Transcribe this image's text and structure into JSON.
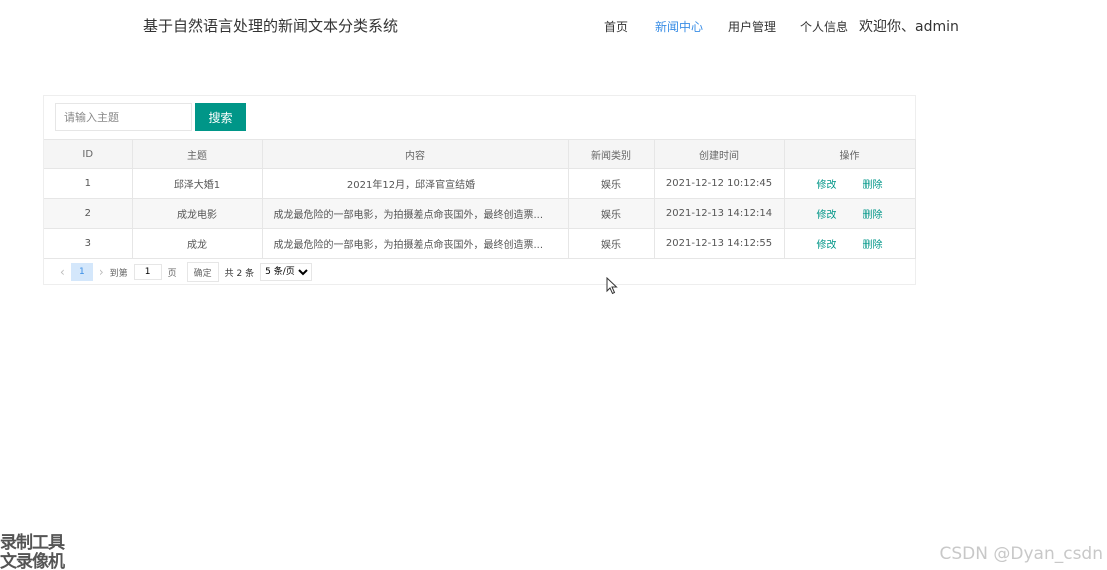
{
  "header": {
    "app_title": "基于自然语言处理的新闻文本分类系统",
    "nav": [
      {
        "label": "首页",
        "active": false
      },
      {
        "label": "新闻中心",
        "active": true
      },
      {
        "label": "用户管理",
        "active": false
      },
      {
        "label": "个人信息",
        "active": false
      }
    ],
    "welcome": "欢迎你、admin",
    "active_color": "#3a8ee6"
  },
  "search": {
    "placeholder": "请输入主题",
    "value": "",
    "button_label": "搜索",
    "button_color": "#009688"
  },
  "table": {
    "columns": [
      "ID",
      "主题",
      "内容",
      "新闻类别",
      "创建时间",
      "操作"
    ],
    "rows": [
      {
        "id": "1",
        "title": "邱泽大婚1",
        "content": "2021年12月，邱泽官宣结婚",
        "category": "娱乐",
        "created": "2021-12-12 10:12:45",
        "edit": "修改",
        "delete": "删除"
      },
      {
        "id": "2",
        "title": "成龙电影",
        "content": "成龙最危险的一部电影，为拍摄差点命丧国外，最终创造票...",
        "category": "娱乐",
        "created": "2021-12-13 14:12:14",
        "edit": "修改",
        "delete": "删除"
      },
      {
        "id": "3",
        "title": "成龙",
        "content": "成龙最危险的一部电影，为拍摄差点命丧国外，最终创造票...",
        "category": "娱乐",
        "created": "2021-12-13 14:12:55",
        "edit": "修改",
        "delete": "删除"
      }
    ]
  },
  "pager": {
    "prev_icon": "‹",
    "current_page": "1",
    "next_icon": "›",
    "goto_prefix": "到第",
    "goto_value": "1",
    "goto_suffix": "页",
    "confirm_label": "确定",
    "total": "共 2 条",
    "page_size": "5 条/页"
  },
  "watermark": "CSDN @Dyan_csdn",
  "corner_logo": {
    "line1": "录制工具",
    "line2": "文录像机"
  }
}
